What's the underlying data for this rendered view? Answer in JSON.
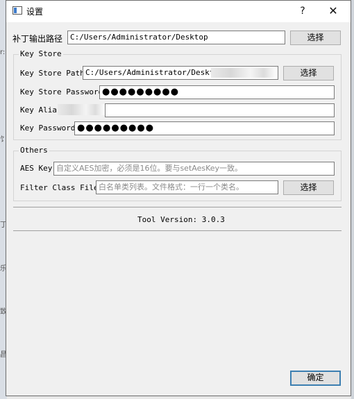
{
  "window": {
    "title": "设置",
    "help_button": "?",
    "close_button": "✕"
  },
  "patch_output": {
    "label": "补丁输出路径",
    "value": "C:/Users/Administrator/Desktop",
    "button": "选择"
  },
  "key_store": {
    "title": "Key Store",
    "path_label": "Key Store Path",
    "path_value": "C:/Users/Administrator/Desktop",
    "path_button": "选择",
    "password_label": "Key Store Password",
    "password_value": "●●●●●●●●●",
    "alias_label": "Key Alia",
    "alias_value": "",
    "key_password_label": "Key Password",
    "key_password_value": "●●●●●●●●●"
  },
  "others": {
    "title": "Others",
    "aes_label": "AES Key",
    "aes_placeholder": "自定义AES加密，必须是16位。要与setAesKey一致。",
    "filter_label": "Filter Class File",
    "filter_placeholder": "白名单类列表。文件格式：一行一个类名。",
    "filter_button": "选择"
  },
  "tool_version": "Tool Version: 3.0.3",
  "ok_button": "确定",
  "background_app": {
    "glyphs": [
      "r:",
      "饣",
      "丁",
      "乐",
      "致",
      "昌"
    ]
  }
}
